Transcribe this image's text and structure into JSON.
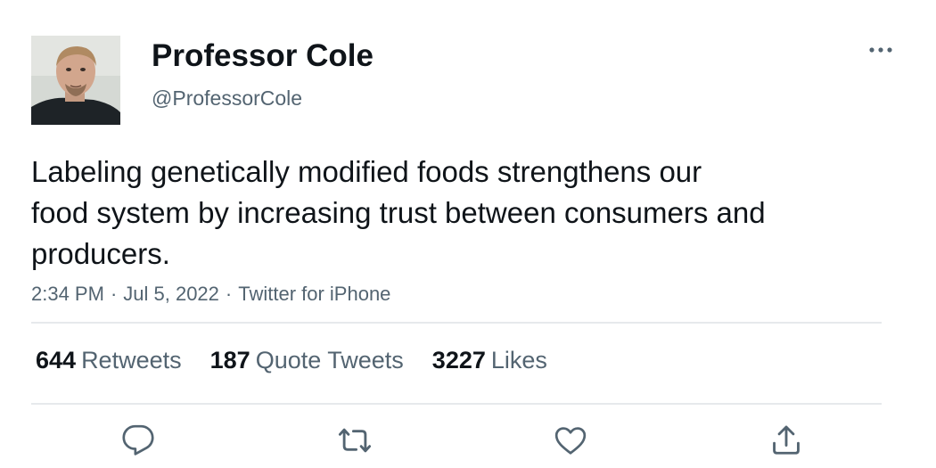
{
  "author": {
    "display_name": "Professor Cole",
    "handle": "@ProfessorCole",
    "avatar_icon": "profile-photo"
  },
  "tweet": {
    "text_lines": [
      "Labeling genetically modified foods strengthens our",
      "food system by increasing trust between consumers and",
      "producers."
    ],
    "time": "2:34 PM",
    "date": "Jul 5, 2022",
    "source": "Twitter for iPhone",
    "separator": "·"
  },
  "stats": {
    "retweets": {
      "count": "644",
      "label": "Retweets"
    },
    "quote_tweets": {
      "count": "187",
      "label": "Quote Tweets"
    },
    "likes": {
      "count": "3227",
      "label": "Likes"
    }
  },
  "actions": {
    "reply_icon": "speech-bubble-icon",
    "retweet_icon": "retweet-arrows-icon",
    "like_icon": "heart-icon",
    "share_icon": "upload-arrow-icon",
    "more_icon": "ellipsis-icon"
  },
  "colors": {
    "text_primary": "#0f1419",
    "text_secondary": "#536471",
    "divider": "#e6e9ec",
    "background": "#ffffff"
  }
}
